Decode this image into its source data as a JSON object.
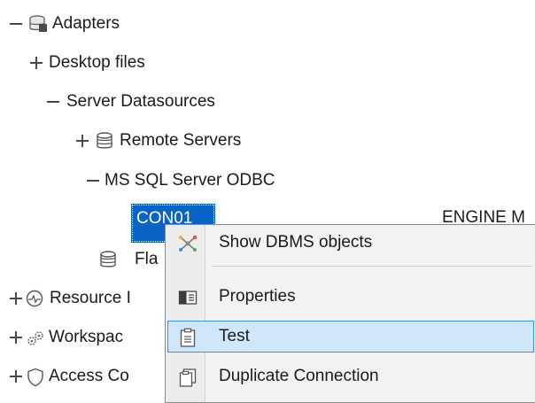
{
  "tree": {
    "adapters": "Adapters",
    "desktop_files": "Desktop files",
    "server_datasources": "Server Datasources",
    "remote_servers": "Remote Servers",
    "ms_sql": "MS SQL Server ODBC",
    "con01": "CON01",
    "engine": "ENGINE M",
    "flat": "Fla",
    "resource": "Resource I",
    "workspace": "Workspac",
    "access": "Access Co"
  },
  "context_menu": {
    "items": [
      {
        "label": "Show DBMS objects",
        "icon": "dbms-objects-icon"
      },
      {
        "label": "Properties",
        "icon": "properties-icon"
      },
      {
        "label": "Test",
        "icon": "test-clipboard-icon"
      },
      {
        "label": "Duplicate Connection",
        "icon": "duplicate-icon"
      }
    ],
    "hover_color": "#cfe6fb",
    "hover_border": "#3c94e4"
  },
  "selection_color": "#0a64c8"
}
